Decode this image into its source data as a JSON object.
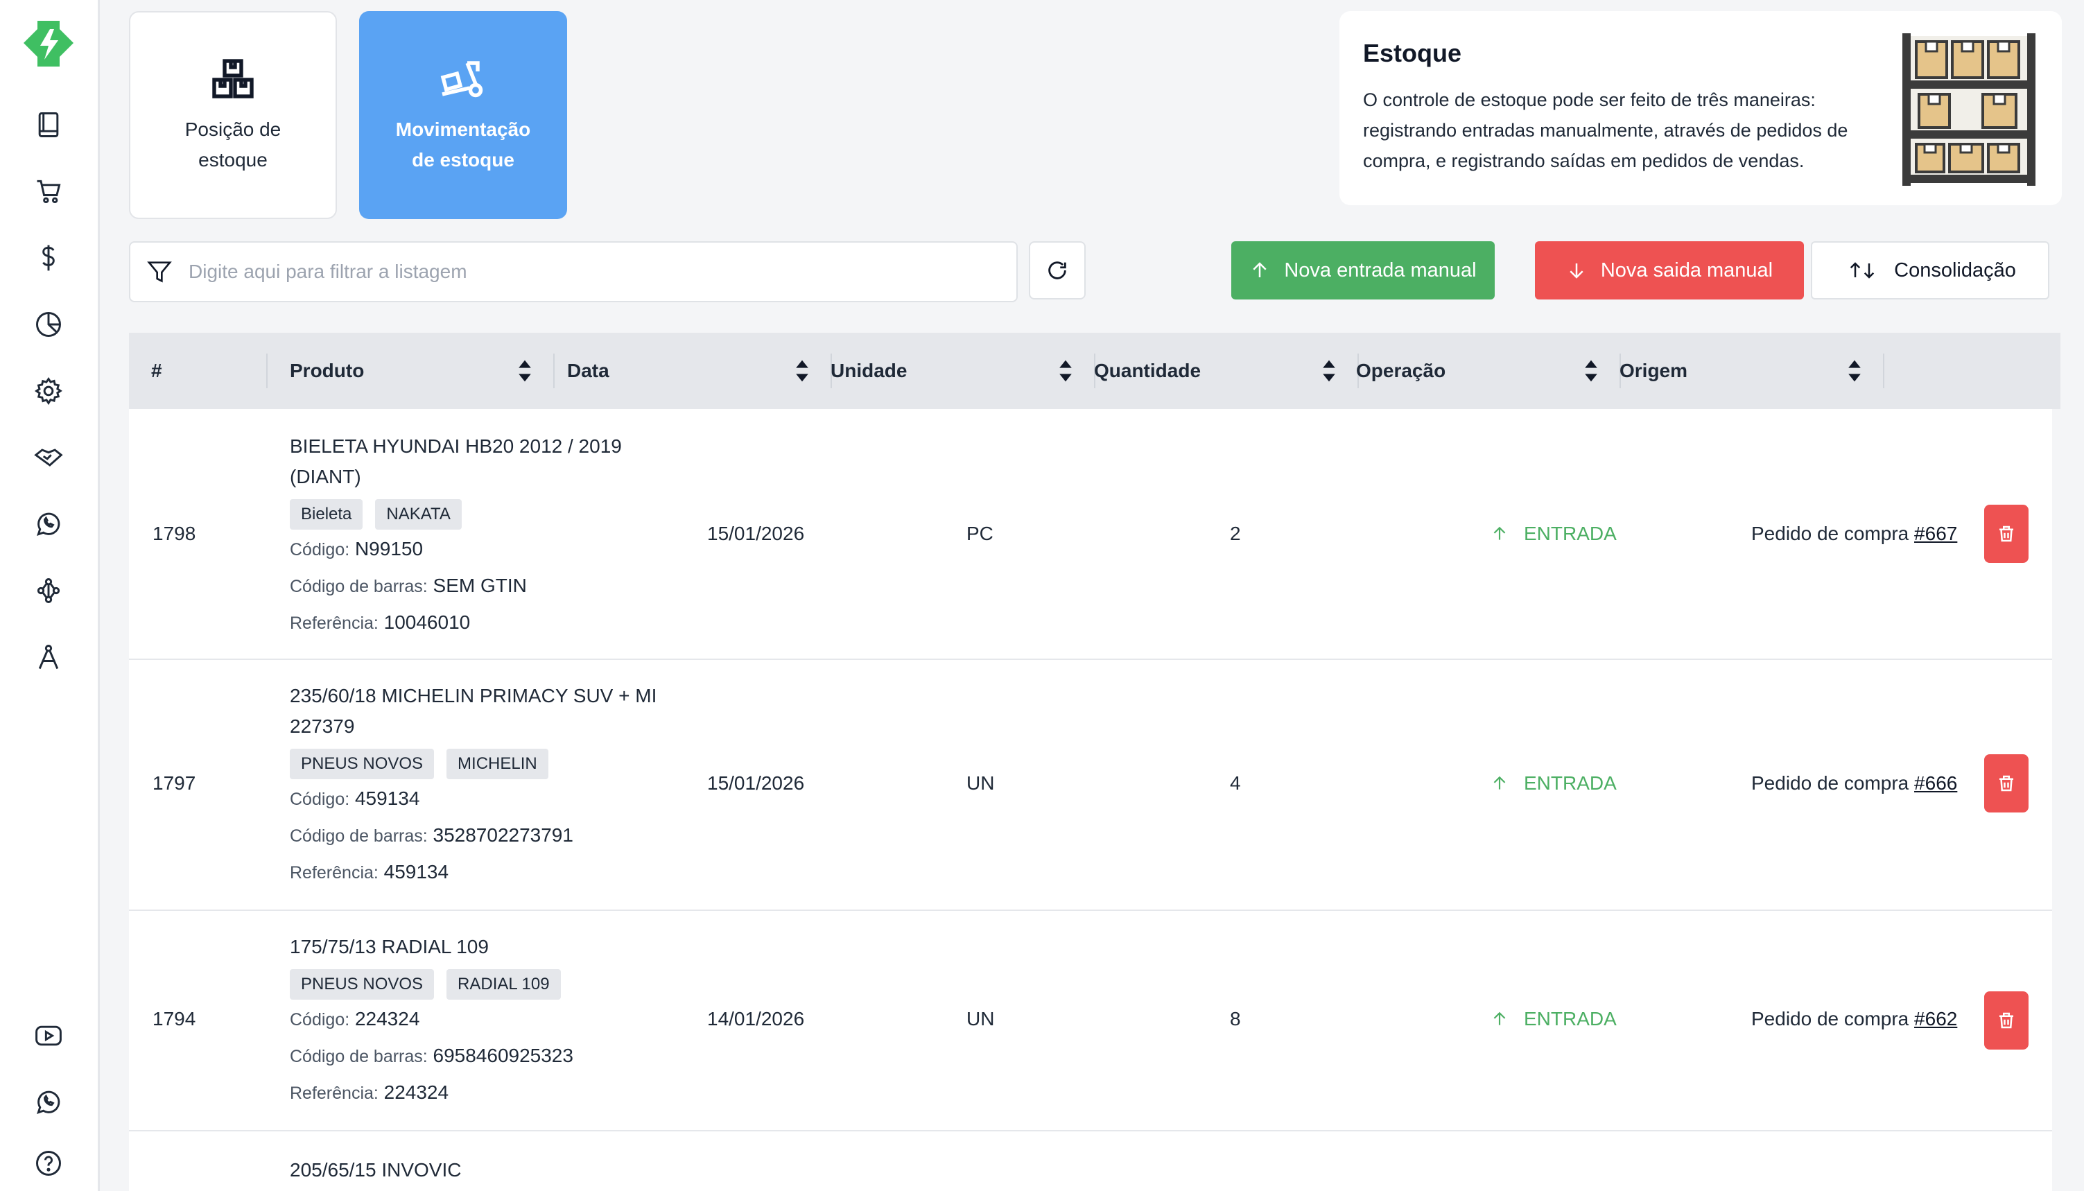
{
  "sidebar": {
    "items": [
      {
        "icon": "book-icon"
      },
      {
        "icon": "cart-icon"
      },
      {
        "icon": "dollar-icon"
      },
      {
        "icon": "pie-chart-icon"
      },
      {
        "icon": "gear-icon"
      },
      {
        "icon": "handshake-icon"
      },
      {
        "icon": "whatsapp-icon"
      },
      {
        "icon": "network-icon"
      },
      {
        "icon": "compass-tool-icon"
      }
    ],
    "bottom": [
      {
        "icon": "youtube-icon"
      },
      {
        "icon": "whatsapp-icon"
      },
      {
        "icon": "help-icon"
      }
    ]
  },
  "modes": {
    "position": "Posição de estoque",
    "movement": "Movimentação de estoque"
  },
  "info": {
    "title": "Estoque",
    "text": "O controle de estoque pode ser feito de três maneiras: registrando entradas manualmente, através de pedidos de compra, e registrando saídas em pedidos de vendas."
  },
  "filter": {
    "placeholder": "Digite aqui para filtrar a listagem"
  },
  "actions": {
    "new_entry": "Nova entrada manual",
    "new_exit": "Nova saida manual",
    "consolidation": "Consolidação"
  },
  "colors": {
    "accent": "#5aa3f3",
    "success": "#4caf63",
    "danger": "#ee5252"
  },
  "table": {
    "headers": [
      "#",
      "Produto",
      "Data",
      "Unidade",
      "Quantidade",
      "Operação",
      "Origem"
    ],
    "labels": {
      "code": "Código:",
      "barcode": "Código de barras:",
      "reference": "Referência:"
    },
    "rows": [
      {
        "id": "1798",
        "name": "BIELETA HYUNDAI HB20 2012 / 2019 (DIANT)",
        "tags": [
          "Bieleta",
          "NAKATA"
        ],
        "code": "N99150",
        "barcode": "SEM GTIN",
        "reference": "10046010",
        "date": "15/01/2026",
        "unit": "PC",
        "qty": "2",
        "operation": "ENTRADA",
        "origin_text": "Pedido de compra",
        "origin_link": "#667"
      },
      {
        "id": "1797",
        "name": "235/60/18 MICHELIN PRIMACY SUV + MI 227379",
        "tags": [
          "PNEUS NOVOS",
          "MICHELIN"
        ],
        "code": "459134",
        "barcode": "3528702273791",
        "reference": "459134",
        "date": "15/01/2026",
        "unit": "UN",
        "qty": "4",
        "operation": "ENTRADA",
        "origin_text": "Pedido de compra",
        "origin_link": "#666"
      },
      {
        "id": "1794",
        "name": "175/75/13 RADIAL 109",
        "tags": [
          "PNEUS NOVOS",
          "RADIAL 109"
        ],
        "code": "224324",
        "barcode": "6958460925323",
        "reference": "224324",
        "date": "14/01/2026",
        "unit": "UN",
        "qty": "8",
        "operation": "ENTRADA",
        "origin_text": "Pedido de compra",
        "origin_link": "#662"
      },
      {
        "name": "205/65/15 INVOVIC"
      }
    ]
  }
}
